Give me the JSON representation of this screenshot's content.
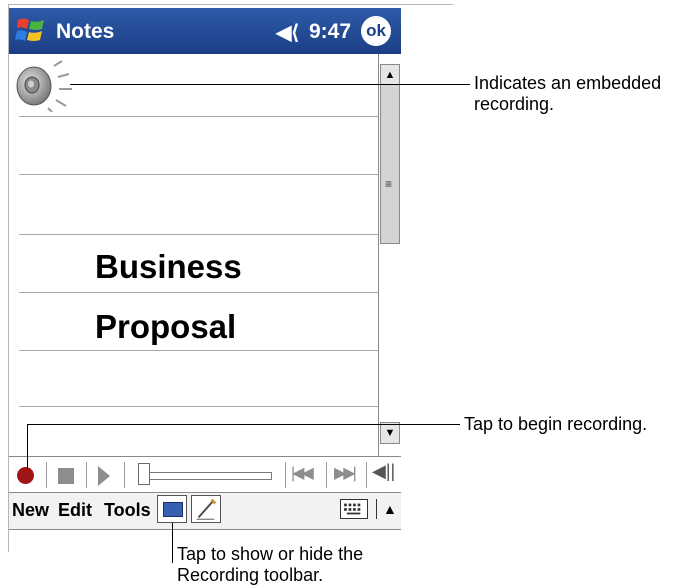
{
  "titlebar": {
    "app_title": "Notes",
    "time": "9:47",
    "ok_label": "ok",
    "speaker_glyph": "◀⟨"
  },
  "note": {
    "line1": "Business",
    "line2": "Proposal"
  },
  "scrollbar": {
    "up": "▲",
    "down": "▼",
    "grip": "≡"
  },
  "recording_toolbar": {
    "skip_back": "|◀◀",
    "skip_forward": "▶▶|",
    "volume_glyph": "◀||"
  },
  "menu": {
    "new": "New",
    "edit": "Edit",
    "tools": "Tools",
    "sip_arrow": "▲"
  },
  "callouts": {
    "embedded": [
      "Indicates an embedded",
      "recording."
    ],
    "record": "Tap to begin recording.",
    "toolbar": [
      "Tap to show or hide the",
      "Recording toolbar."
    ]
  },
  "colors": {
    "title_bar": "#1b3f86",
    "record": "#a01616"
  },
  "icons": [
    "windows-start-icon",
    "speaker-icon",
    "embedded-recording-icon",
    "record-icon",
    "stop-icon",
    "play-icon",
    "skip-back-icon",
    "skip-forward-icon",
    "volume-icon",
    "recording-toolbar-icon",
    "pen-icon",
    "keyboard-icon"
  ]
}
